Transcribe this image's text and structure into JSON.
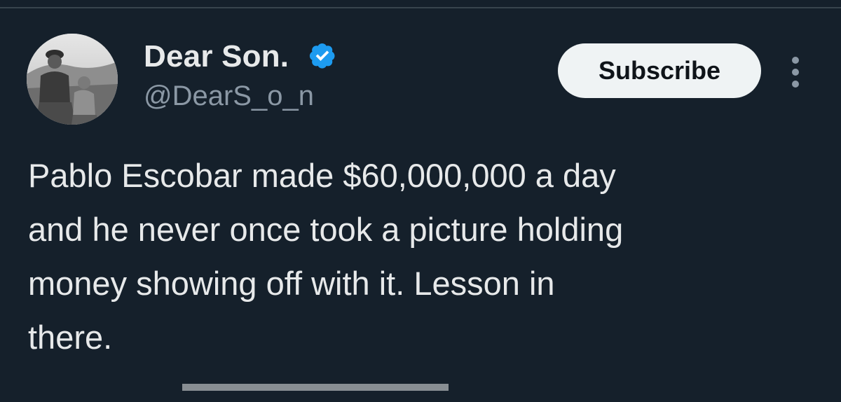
{
  "post": {
    "author": {
      "display_name": "Dear Son.",
      "handle": "@DearS_o_n",
      "verified": true,
      "avatar": "avatar-photo-man-with-boy"
    },
    "subscribe_label": "Subscribe",
    "more_icon": "more-vertical-icon",
    "text_lines": [
      "Pablo Escobar made $60,000,000 a day",
      "and he never once took a picture holding",
      "money showing off with it. Lesson in",
      "there."
    ]
  },
  "colors": {
    "background": "#15202b",
    "primary_text": "#e7e9ea",
    "secondary_text": "#8b98a5",
    "verified_blue": "#1d9bf0",
    "button_bg": "#eff3f4"
  }
}
